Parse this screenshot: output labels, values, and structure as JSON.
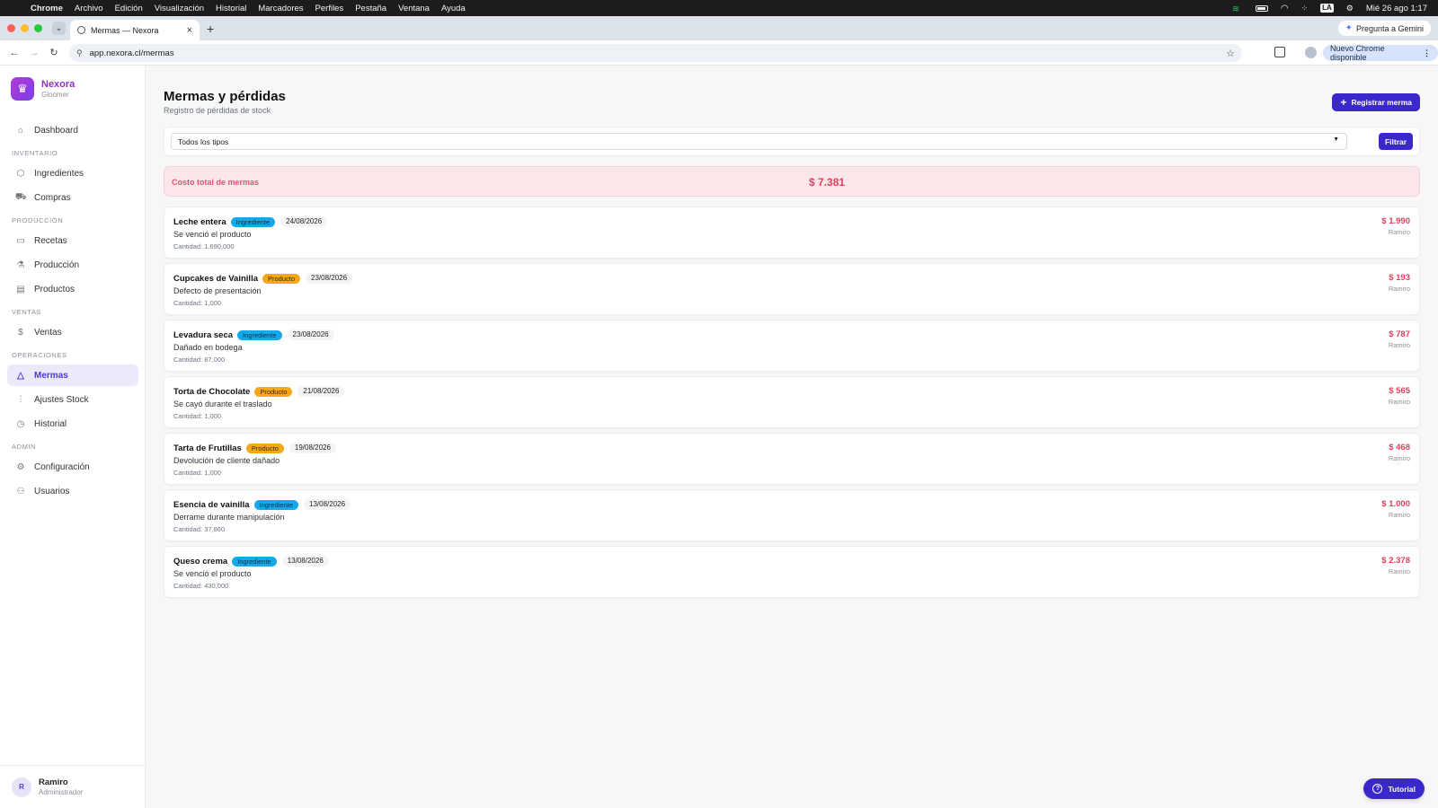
{
  "os": {
    "menu": [
      "Chrome",
      "Archivo",
      "Edición",
      "Visualización",
      "Historial",
      "Marcadores",
      "Perfiles",
      "Pestaña",
      "Ventana",
      "Ayuda"
    ],
    "input_source": "LA",
    "clock": "Mié 26 ago 1:17"
  },
  "browser": {
    "tab_title": "Mermas — Nexora",
    "url": "app.nexora.cl/mermas",
    "gemini_label": "Pregunta a Gemini",
    "update_label": "Nuevo Chrome disponible"
  },
  "sidebar": {
    "brand": {
      "name": "Nexora",
      "org": "Gloomer"
    },
    "dashboard": "Dashboard",
    "sections": [
      {
        "title": "INVENTARIO",
        "items": [
          {
            "label": "Ingredientes",
            "icon": "box-icon"
          },
          {
            "label": "Compras",
            "icon": "cart-icon"
          }
        ]
      },
      {
        "title": "PRODUCCIÓN",
        "items": [
          {
            "label": "Recetas",
            "icon": "book-icon"
          },
          {
            "label": "Producción",
            "icon": "flask-icon"
          },
          {
            "label": "Productos",
            "icon": "archive-icon"
          }
        ]
      },
      {
        "title": "VENTAS",
        "items": [
          {
            "label": "Ventas",
            "icon": "dollar-icon"
          }
        ]
      },
      {
        "title": "OPERACIONES",
        "items": [
          {
            "label": "Mermas",
            "icon": "warning-icon",
            "active": true
          },
          {
            "label": "Ajustes Stock",
            "icon": "sliders-icon"
          },
          {
            "label": "Historial",
            "icon": "clock-icon"
          }
        ]
      },
      {
        "title": "ADMIN",
        "items": [
          {
            "label": "Configuración",
            "icon": "gear-icon"
          },
          {
            "label": "Usuarios",
            "icon": "users-icon"
          }
        ]
      }
    ],
    "user": {
      "initial": "R",
      "name": "Ramiro",
      "role": "Administrador"
    }
  },
  "page": {
    "title": "Mermas y pérdidas",
    "subtitle": "Registro de pérdidas de stock",
    "register_button": "Registrar merma",
    "filter": {
      "selected": "Todos los tipos",
      "button": "Filtrar"
    },
    "total": {
      "label": "Costo total de mermas",
      "amount": "$ 7.381"
    },
    "tutorial_button": "Tutorial"
  },
  "mermas": [
    {
      "name": "Leche entera",
      "type": "Ingrediente",
      "date": "24/08/2026",
      "reason": "Se venció el producto",
      "quantity": "Cantidad: 1.690,000",
      "cost": "$ 1.990",
      "user": "Ramiro"
    },
    {
      "name": "Cupcakes de Vainilla",
      "type": "Producto",
      "date": "23/08/2026",
      "reason": "Defecto de presentación",
      "quantity": "Cantidad: 1,000",
      "cost": "$ 193",
      "user": "Ramiro"
    },
    {
      "name": "Levadura seca",
      "type": "Ingrediente",
      "date": "23/08/2026",
      "reason": "Dañado en bodega",
      "quantity": "Cantidad: 87,000",
      "cost": "$ 787",
      "user": "Ramiro"
    },
    {
      "name": "Torta de Chocolate",
      "type": "Producto",
      "date": "21/08/2026",
      "reason": "Se cayó durante el traslado",
      "quantity": "Cantidad: 1,000",
      "cost": "$ 565",
      "user": "Ramiro"
    },
    {
      "name": "Tarta de Frutillas",
      "type": "Producto",
      "date": "19/08/2026",
      "reason": "Devolución de cliente dañado",
      "quantity": "Cantidad: 1,000",
      "cost": "$ 468",
      "user": "Ramiro"
    },
    {
      "name": "Esencia de vainilla",
      "type": "Ingrediente",
      "date": "13/08/2026",
      "reason": "Derrame durante manipulación",
      "quantity": "Cantidad: 37,860",
      "cost": "$ 1.000",
      "user": "Ramiro"
    },
    {
      "name": "Queso crema",
      "type": "Ingrediente",
      "date": "13/08/2026",
      "reason": "Se venció el producto",
      "quantity": "Cantidad: 430,000",
      "cost": "$ 2.378",
      "user": "Ramiro"
    }
  ],
  "colors": {
    "accent": "#3b28cc",
    "loss": "#e2405f",
    "ingredient": "#16a9ea",
    "product": "#f6a917"
  }
}
